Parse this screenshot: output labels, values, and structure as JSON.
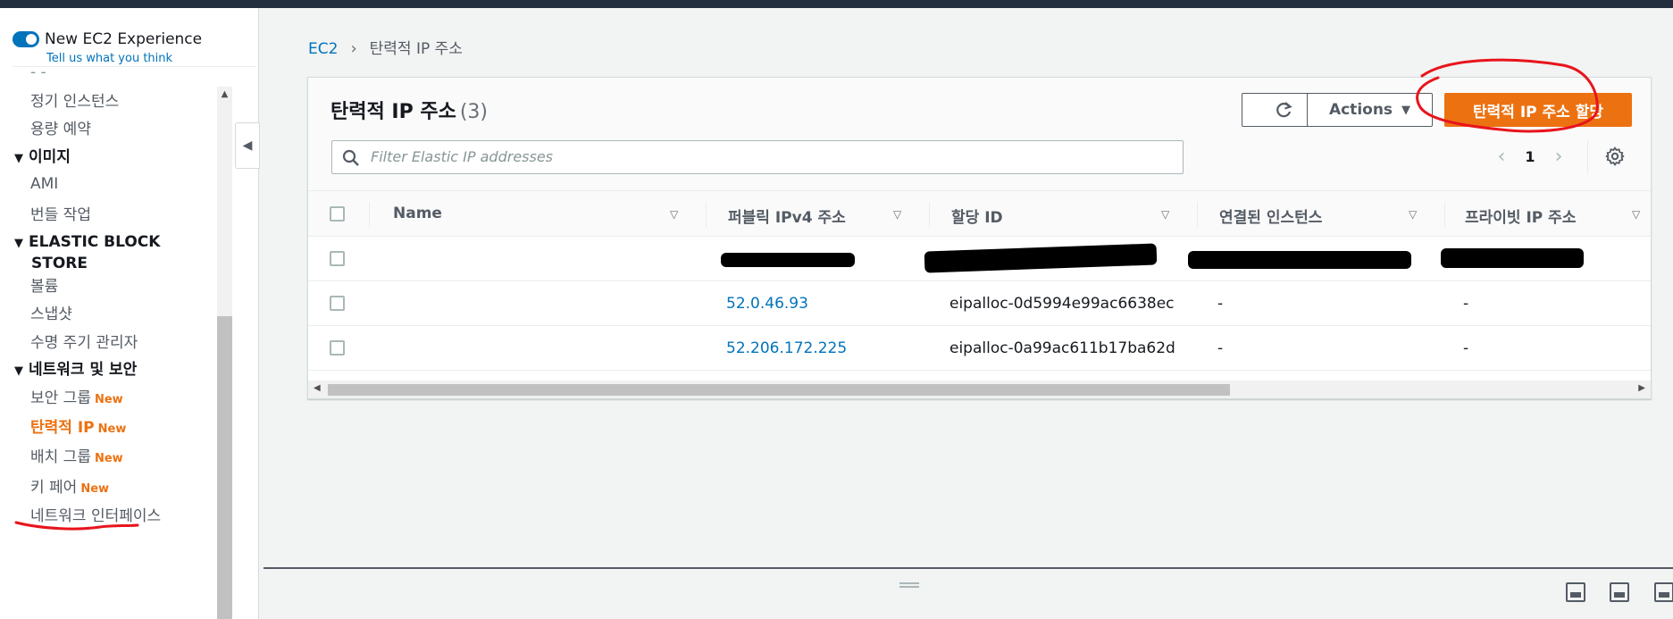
{
  "experience": {
    "title": "New EC2 Experience",
    "feedback_link": "Tell us what you think"
  },
  "sidebar": {
    "truncated_item": "- -",
    "items_top": [
      {
        "label": "정기 인스턴스"
      },
      {
        "label": "용량 예약"
      }
    ],
    "section_images": {
      "heading": "이미지",
      "items": [
        {
          "label": "AMI"
        },
        {
          "label": "번들 작업"
        }
      ]
    },
    "section_ebs": {
      "heading_line1": "ELASTIC BLOCK",
      "heading_line2": "STORE",
      "items": [
        {
          "label": "볼륨"
        },
        {
          "label": "스냅샷"
        },
        {
          "label": "수명 주기 관리자"
        }
      ]
    },
    "section_network": {
      "heading": "네트워크 및 보안",
      "items": [
        {
          "label": "보안 그룹",
          "badge": "New"
        },
        {
          "label": "탄력적 IP",
          "badge": "New"
        },
        {
          "label": "배치 그룹",
          "badge": "New"
        },
        {
          "label": "키 페어",
          "badge": "New"
        },
        {
          "label": "네트워크 인터페이스"
        }
      ]
    }
  },
  "breadcrumb": {
    "root": "EC2",
    "current": "탄력적 IP 주소"
  },
  "panel": {
    "title": "탄력적 IP 주소",
    "count": "(3)",
    "actions_label": "Actions",
    "primary_label": "탄력적 IP 주소 할당",
    "search_placeholder": "Filter Elastic IP addresses",
    "page": "1"
  },
  "table": {
    "columns": [
      "Name",
      "퍼블릭 IPv4 주소",
      "할당 ID",
      "연결된 인스턴스",
      "프라이빗 IP 주소"
    ],
    "rows": [
      {
        "name": "",
        "public_ip": "52.0.46.93",
        "allocation_id": "eipalloc-0d5994e99ac6638ec",
        "instance": "-",
        "private_ip": "-"
      },
      {
        "name": "",
        "public_ip": "52.206.172.225",
        "allocation_id": "eipalloc-0a99ac611b17ba62d",
        "instance": "-",
        "private_ip": "-"
      }
    ]
  },
  "colors": {
    "accent_orange": "#ec7211",
    "link_blue": "#0073bb",
    "annotation_red": "#e8141c"
  }
}
